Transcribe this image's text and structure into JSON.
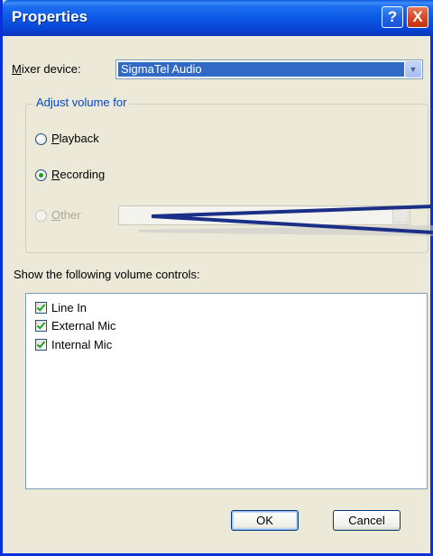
{
  "window": {
    "title": "Properties"
  },
  "titlebar_buttons": {
    "help": "?",
    "close": "X"
  },
  "mixer": {
    "label_prefix": "",
    "label_mnemonic": "M",
    "label_rest": "ixer device:",
    "value": "SigmaTel Audio"
  },
  "adjust_group": {
    "legend": "Adjust volume for",
    "options": [
      {
        "mnemonic": "P",
        "rest": "layback",
        "selected": false,
        "enabled": true
      },
      {
        "mnemonic": "R",
        "rest": "ecording",
        "selected": true,
        "enabled": true
      },
      {
        "mnemonic": "O",
        "rest": "ther",
        "selected": false,
        "enabled": false
      }
    ],
    "other_value": ""
  },
  "controls": {
    "label": "Show the following volume controls:",
    "items": [
      {
        "label": "Line In",
        "checked": true
      },
      {
        "label": "External Mic",
        "checked": true
      },
      {
        "label": "Internal Mic",
        "checked": true
      }
    ]
  },
  "buttons": {
    "ok": "OK",
    "cancel": "Cancel"
  },
  "colors": {
    "titlebar": "#0a56e4",
    "selection": "#316ac5",
    "annotation": "#1c2f86"
  },
  "icons": [
    "help-icon",
    "close-icon",
    "dropdown-arrow-icon",
    "check-icon"
  ]
}
